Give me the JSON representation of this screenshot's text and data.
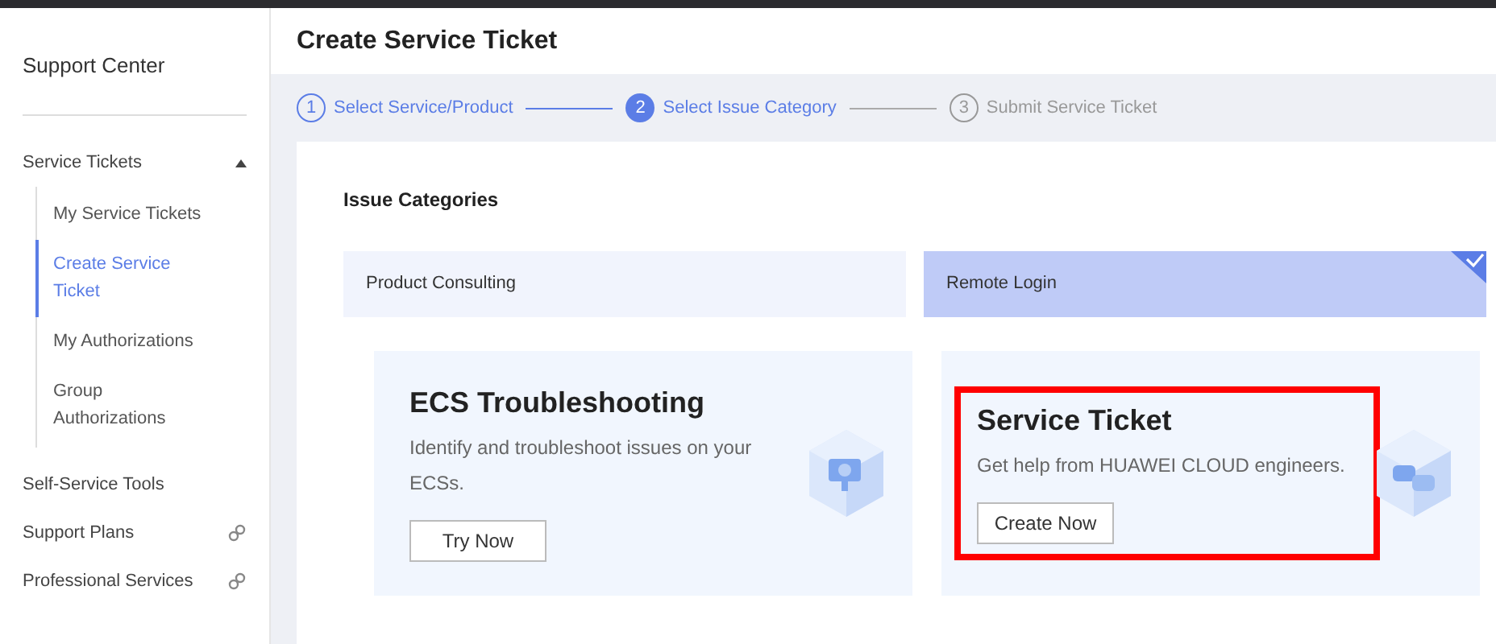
{
  "sidebar": {
    "title": "Support Center",
    "items": [
      {
        "label": "Service Tickets",
        "expanded": true,
        "kind": "group",
        "children": [
          {
            "label": "My Service Tickets",
            "selected": false
          },
          {
            "label": "Create Service Ticket",
            "selected": true
          },
          {
            "label": "My Authorizations",
            "selected": false
          },
          {
            "label": "Group Authorizations",
            "selected": false
          }
        ]
      },
      {
        "label": "Self-Service Tools",
        "kind": "plain"
      },
      {
        "label": "Support Plans",
        "kind": "link"
      },
      {
        "label": "Professional Services",
        "kind": "link"
      }
    ]
  },
  "page": {
    "title": "Create Service Ticket"
  },
  "steps": [
    {
      "number": "1",
      "label": "Select Service/Product",
      "completed": true,
      "selected": false
    },
    {
      "number": "2",
      "label": "Select Issue Category",
      "completed": false,
      "selected": true
    },
    {
      "number": "3",
      "label": "Submit Service Ticket",
      "completed": false,
      "selected": false
    }
  ],
  "issue_categories": {
    "title": "Issue Categories",
    "items": [
      {
        "label": "Product Consulting",
        "selected": false
      },
      {
        "label": "Remote Login",
        "selected": true
      }
    ]
  },
  "options": [
    {
      "title": "ECS Troubleshooting",
      "description": "Identify and troubleshoot issues on your ECSs.",
      "button": "Try Now",
      "highlighted": false
    },
    {
      "title": "Service Ticket",
      "description": "Get help from HUAWEI CLOUD engineers.",
      "button": "Create Now",
      "highlighted": true
    }
  ]
}
